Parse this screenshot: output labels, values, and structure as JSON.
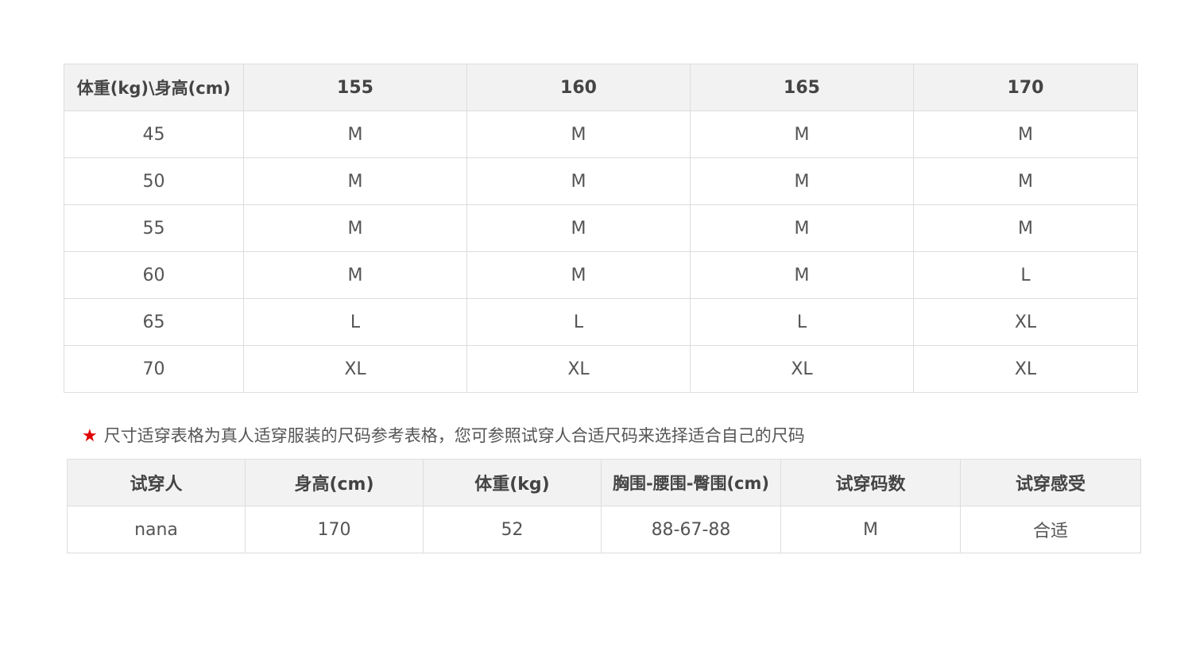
{
  "size_table": {
    "corner_header": "体重(kg)\\身高(cm)",
    "height_headers": [
      "155",
      "160",
      "165",
      "170"
    ],
    "rows": [
      {
        "weight": "45",
        "sizes": [
          "M",
          "M",
          "M",
          "M"
        ]
      },
      {
        "weight": "50",
        "sizes": [
          "M",
          "M",
          "M",
          "M"
        ]
      },
      {
        "weight": "55",
        "sizes": [
          "M",
          "M",
          "M",
          "M"
        ]
      },
      {
        "weight": "60",
        "sizes": [
          "M",
          "M",
          "M",
          "L"
        ]
      },
      {
        "weight": "65",
        "sizes": [
          "L",
          "L",
          "L",
          "XL"
        ]
      },
      {
        "weight": "70",
        "sizes": [
          "XL",
          "XL",
          "XL",
          "XL"
        ]
      }
    ]
  },
  "note": {
    "icon": "star-icon",
    "icon_color": "#e00000",
    "text": "尺寸适穿表格为真人适穿服装的尺码参考表格，您可参照试穿人合适尺码来选择适合自己的尺码"
  },
  "tryon_table": {
    "headers": [
      "试穿人",
      "身高(cm)",
      "体重(kg)",
      "胸围-腰围-臀围(cm)",
      "试穿码数",
      "试穿感受"
    ],
    "rows": [
      [
        "nana",
        "170",
        "52",
        "88-67-88",
        "M",
        "合适"
      ]
    ]
  }
}
